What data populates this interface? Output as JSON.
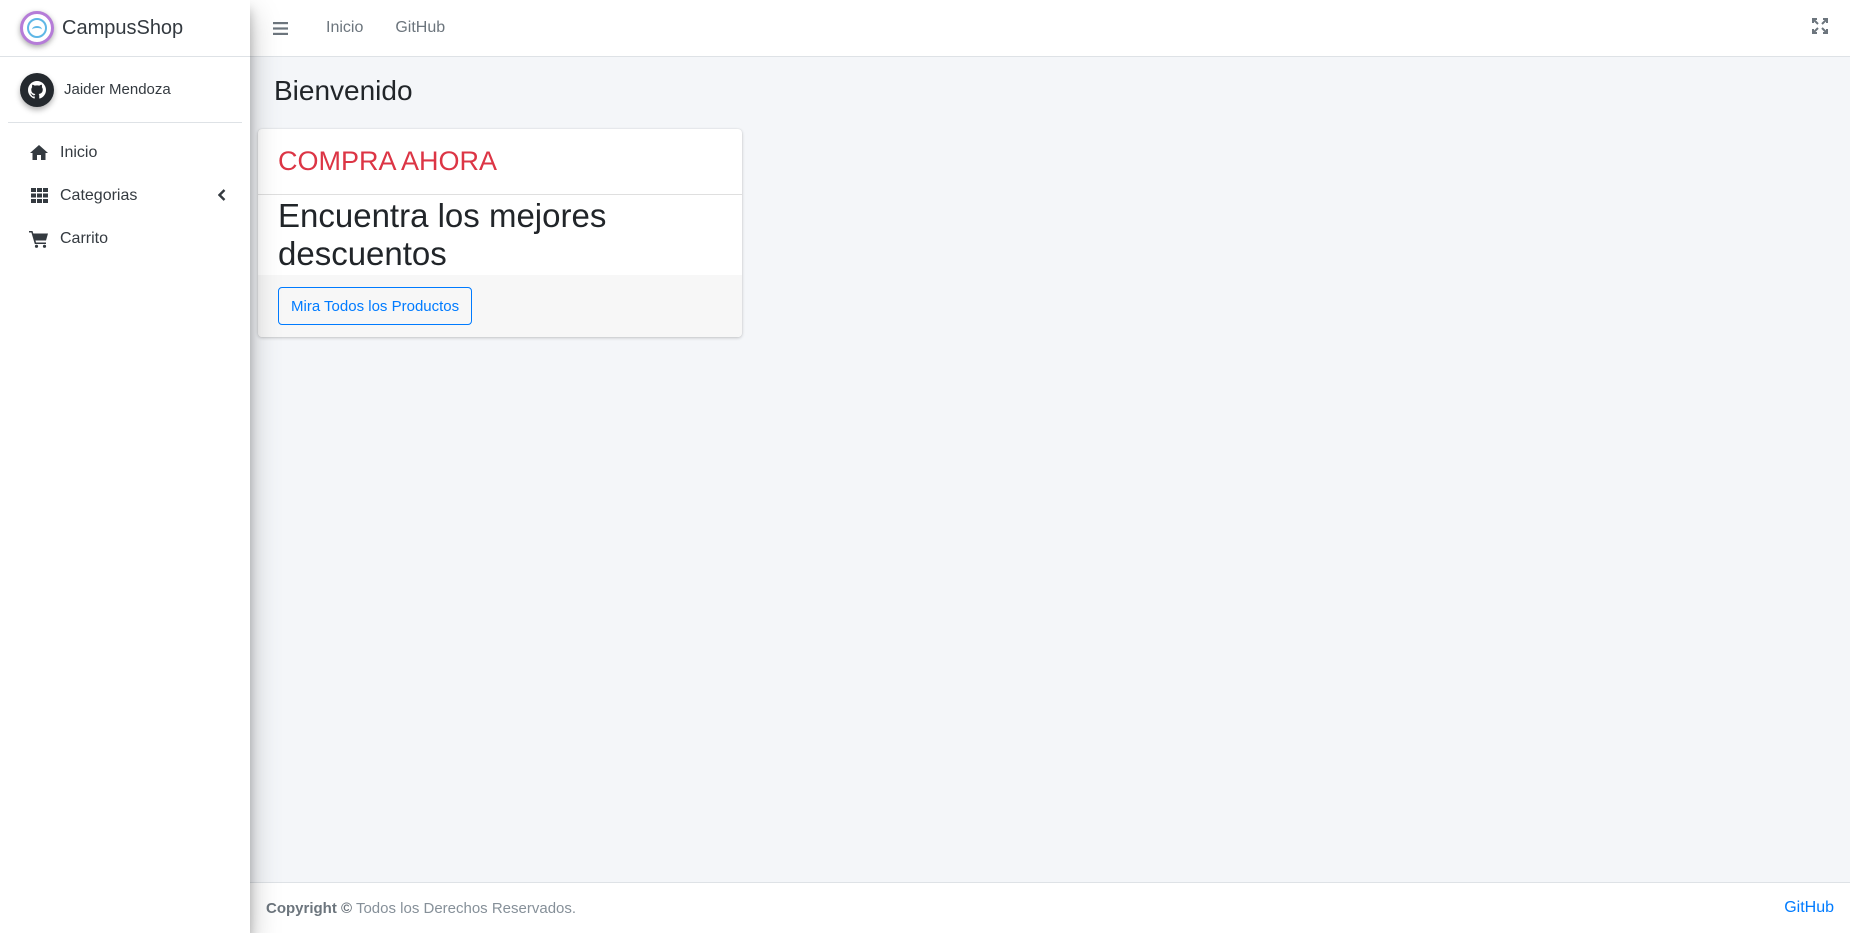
{
  "brand": {
    "name": "CampusShop"
  },
  "user": {
    "name": "Jaider Mendoza"
  },
  "sidebar": {
    "items": [
      {
        "label": "Inicio",
        "icon": "home-icon"
      },
      {
        "label": "Categorias",
        "icon": "grid-icon",
        "caret": "chevron-left-icon"
      },
      {
        "label": "Carrito",
        "icon": "cart-icon"
      }
    ]
  },
  "topbar": {
    "menu_icon": "bars-icon",
    "links": [
      "Inicio",
      "GitHub"
    ],
    "fullscreen_icon": "expand-icon"
  },
  "main": {
    "page_title": "Bienvenido",
    "card": {
      "header": "COMPRA AHORA",
      "text": "Encuentra los mejores descuentos",
      "button": "Mira Todos los Productos"
    }
  },
  "footer": {
    "copyright_bold": "Copyright ©",
    "copyright_rest": " Todos los Derechos Reservados.",
    "link": "GitHub"
  },
  "colors": {
    "accent": "#007bff",
    "header_red": "#dc3545",
    "background": "#f4f6f9"
  }
}
